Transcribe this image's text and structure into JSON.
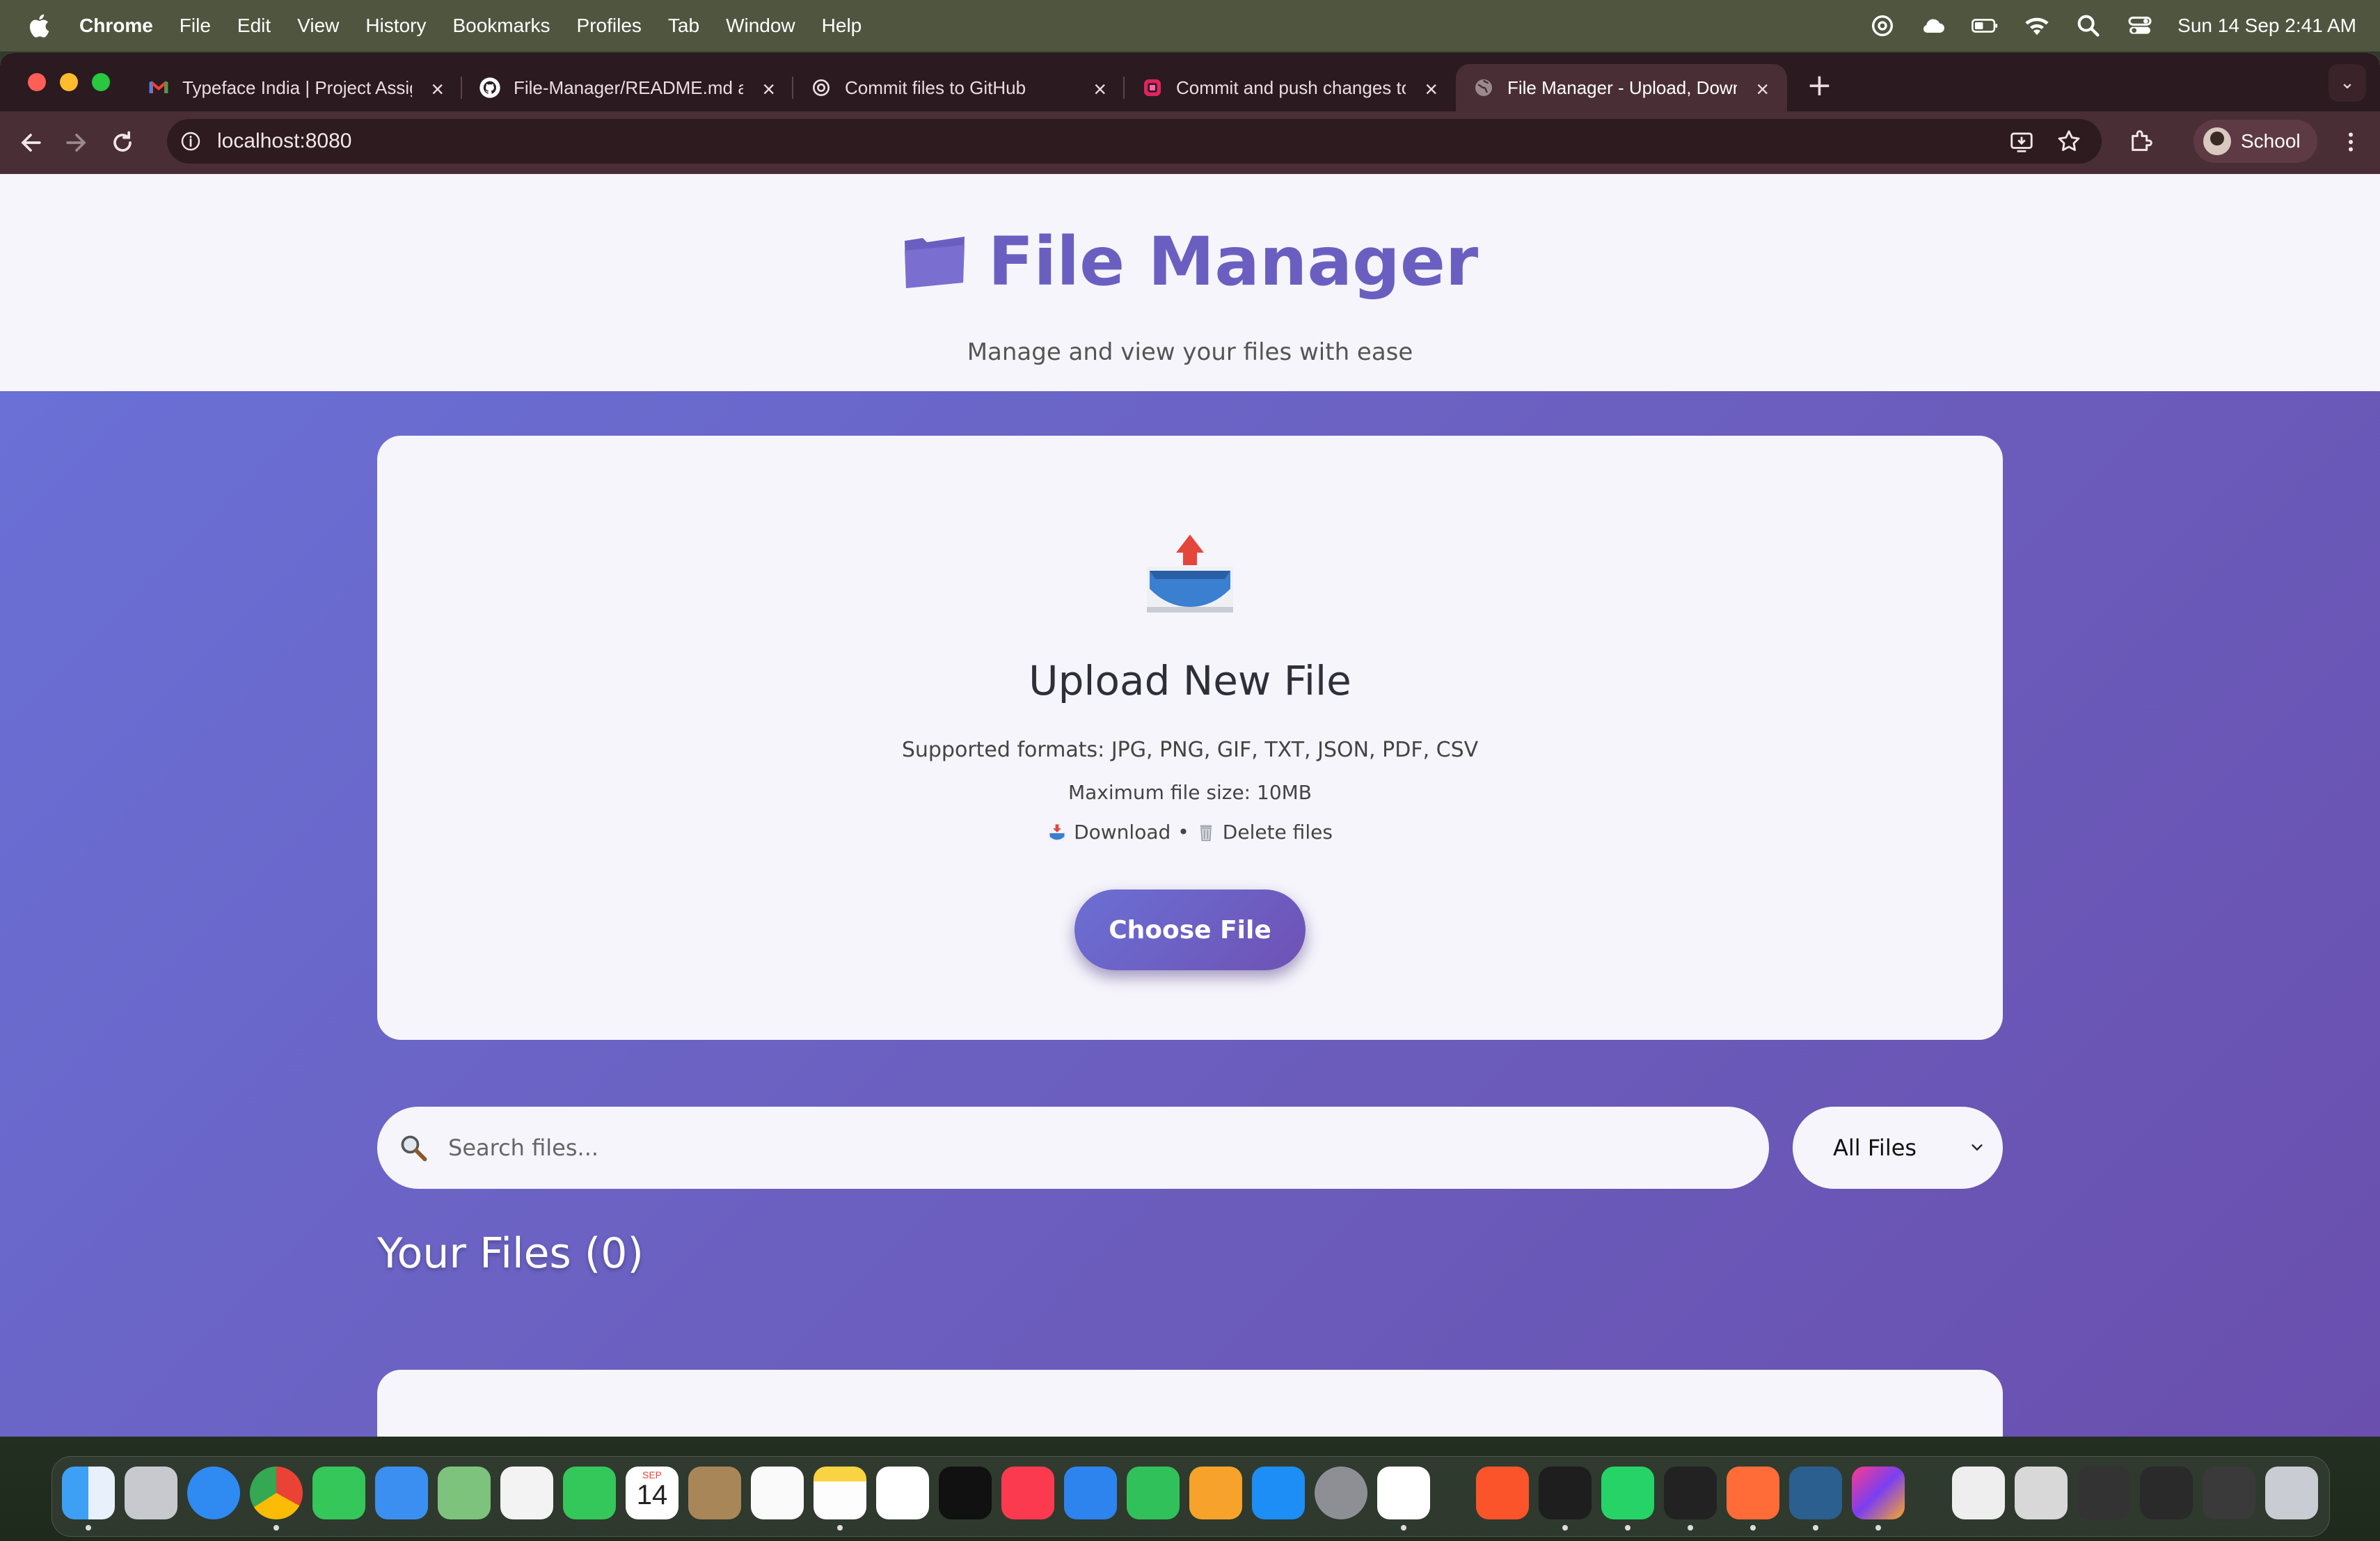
{
  "menubar": {
    "app": "Chrome",
    "items": [
      "File",
      "Edit",
      "View",
      "History",
      "Bookmarks",
      "Profiles",
      "Tab",
      "Window",
      "Help"
    ],
    "datetime": "Sun 14 Sep  2:41 AM"
  },
  "tabs": [
    {
      "title": "Typeface India | Project Assig",
      "icon": "gmail-icon"
    },
    {
      "title": "File-Manager/README.md at",
      "icon": "github-icon"
    },
    {
      "title": "Commit files to GitHub",
      "icon": "chatgpt-icon"
    },
    {
      "title": "Commit and push changes to",
      "icon": "app-icon"
    },
    {
      "title": "File Manager - Upload, Downl",
      "icon": "globe-icon",
      "active": true
    }
  ],
  "address_bar": {
    "url": "localhost:8080"
  },
  "profile": {
    "name": "School"
  },
  "page": {
    "title": "File Manager",
    "subtitle": "Manage and view your files with ease",
    "upload": {
      "title": "Upload New File",
      "formats": "Supported formats: JPG, PNG, GIF, TXT, JSON, PDF, CSV",
      "max_size": "Maximum file size: 10MB",
      "download_label": "Download",
      "bullet": "•",
      "delete_label": "Delete files",
      "button": "Choose File"
    },
    "search": {
      "placeholder": "Search files..."
    },
    "filter": {
      "selected": "All Files"
    },
    "files_heading": "Your Files (0)"
  },
  "dock": {
    "apps": [
      "Finder",
      "Launchpad",
      "Safari",
      "Chrome",
      "Messages",
      "Mail",
      "Maps",
      "Photos",
      "FaceTime",
      "Calendar",
      "Contacts",
      "Reminders",
      "Notes",
      "Freeform",
      "TV",
      "Music",
      "Keynote",
      "Numbers",
      "Pages",
      "App Store",
      "System Settings",
      "ChatGPT",
      "Brave",
      "Terminal",
      "WhatsApp",
      "Cursor",
      "Postman",
      "MySQL Workbench",
      "IntelliJ IDEA"
    ],
    "calendar_month": "SEP",
    "calendar_day": "14"
  },
  "colors": {
    "accent": "#6a5fc1",
    "gradient_start": "#6a70d6",
    "gradient_end": "#6a4fae",
    "chrome_frame": "#4a2e36"
  }
}
